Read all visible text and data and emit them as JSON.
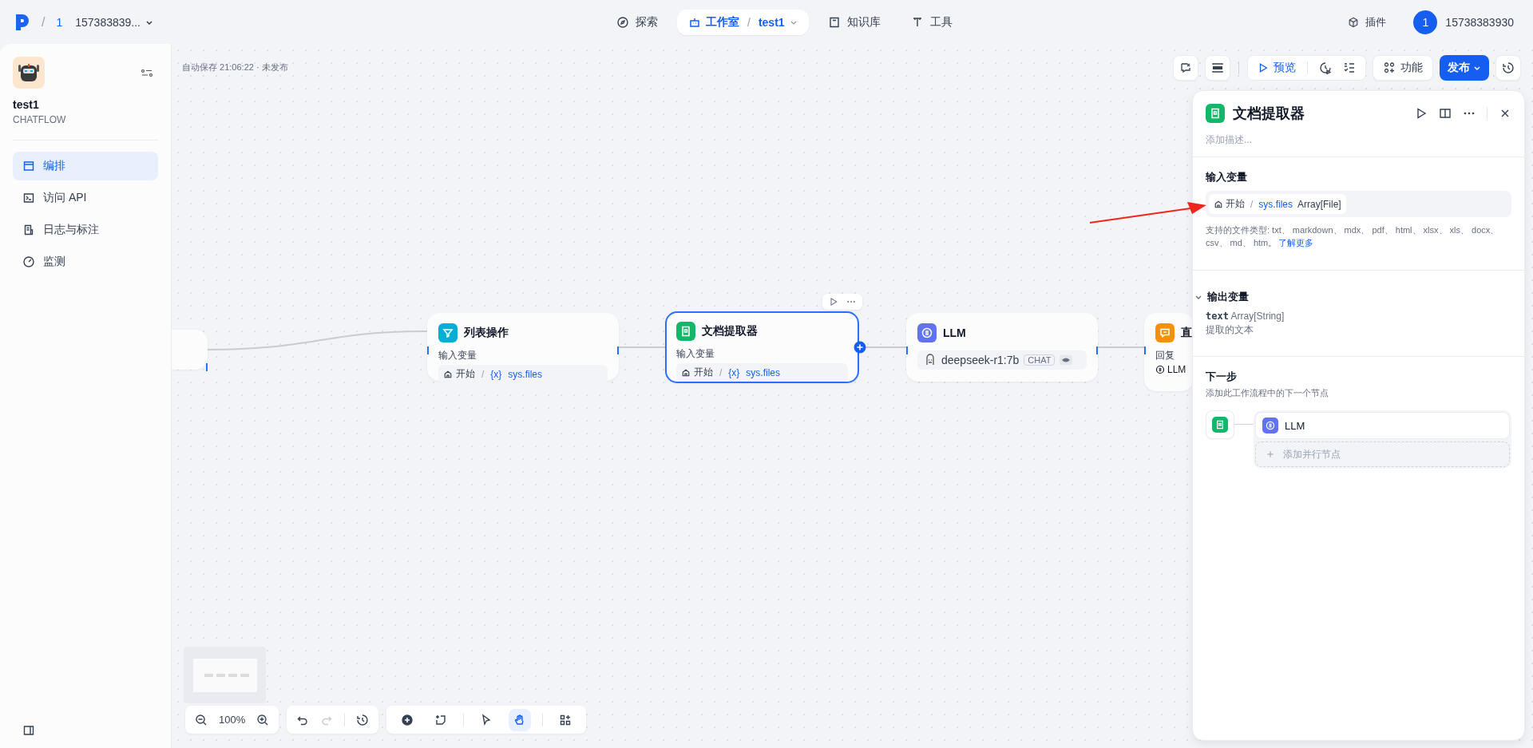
{
  "top_bar": {
    "separator": "/",
    "workspace_number": "1",
    "account": "157383839...",
    "nav": [
      {
        "label": "探索",
        "selected": false
      },
      {
        "label": "工作室",
        "selected": true,
        "separator": "/",
        "app": "test1"
      },
      {
        "label": "知识库",
        "selected": false
      },
      {
        "label": "工具",
        "selected": false
      }
    ],
    "plugins": "插件",
    "user_initial": "1",
    "user_name": "15738383930"
  },
  "sidebar": {
    "app_name": "test1",
    "app_type": "CHATFLOW",
    "items": [
      {
        "label": "编排",
        "selected": true
      },
      {
        "label": "访问 API",
        "selected": false
      },
      {
        "label": "日志与标注",
        "selected": false
      },
      {
        "label": "监测",
        "selected": false
      }
    ]
  },
  "canvas": {
    "autosave": "自动保存 21:06:22 · 未发布",
    "nodes": [
      {
        "kind": "start",
        "selected": false
      },
      {
        "kind": "list",
        "title": "列表操作",
        "section": "输入变量",
        "var": {
          "source": "开始",
          "separator": "/",
          "prefix": "{x}",
          "name": "sys.files"
        },
        "selected": false
      },
      {
        "kind": "doc",
        "title": "文档提取器",
        "section": "输入变量",
        "var": {
          "source": "开始",
          "separator": "/",
          "prefix": "{x}",
          "name": "sys.files"
        },
        "selected": true
      },
      {
        "kind": "llm",
        "title": "LLM",
        "model": "deepseek-r1:7b",
        "badge": "CHAT",
        "selected": false
      },
      {
        "kind": "answer",
        "title": "直",
        "section": "回复",
        "ref": "LLM",
        "selected": false
      }
    ],
    "zoom": "100%",
    "tools": [
      {
        "kind": "undo",
        "disabled": false
      },
      {
        "kind": "redo",
        "disabled": true
      },
      {
        "kind": "history",
        "disabled": false
      }
    ],
    "modes": [
      {
        "kind": "add",
        "selected": false
      },
      {
        "kind": "note",
        "selected": false
      },
      {
        "kind": "pointer",
        "selected": false
      },
      {
        "kind": "hand",
        "selected": true
      },
      {
        "kind": "organize",
        "selected": false
      }
    ]
  },
  "toolbar": {
    "preview": "预览",
    "features": "功能",
    "publish": "发布"
  },
  "panel": {
    "kind": "doc",
    "title": "文档提取器",
    "description_placeholder": "添加描述...",
    "input": {
      "title": "输入变量",
      "source": "开始",
      "separator": "/",
      "name": "sys.files",
      "type": "Array[File]",
      "supported": "支持的文件类型: txt、 markdown、 mdx、 pdf、 html、 xlsx、 xls、 docx、 csv、 md、 htm。",
      "link": "了解更多"
    },
    "output": {
      "title": "输出变量",
      "expanded": true,
      "vars": [
        {
          "name": "text",
          "type": "Array[String]",
          "description": "提取的文本"
        }
      ]
    },
    "next": {
      "title": "下一步",
      "hint": "添加此工作流程中的下一个节点",
      "nodes": [
        {
          "kind": "llm",
          "title": "LLM"
        }
      ],
      "add": "添加并行节点"
    }
  }
}
